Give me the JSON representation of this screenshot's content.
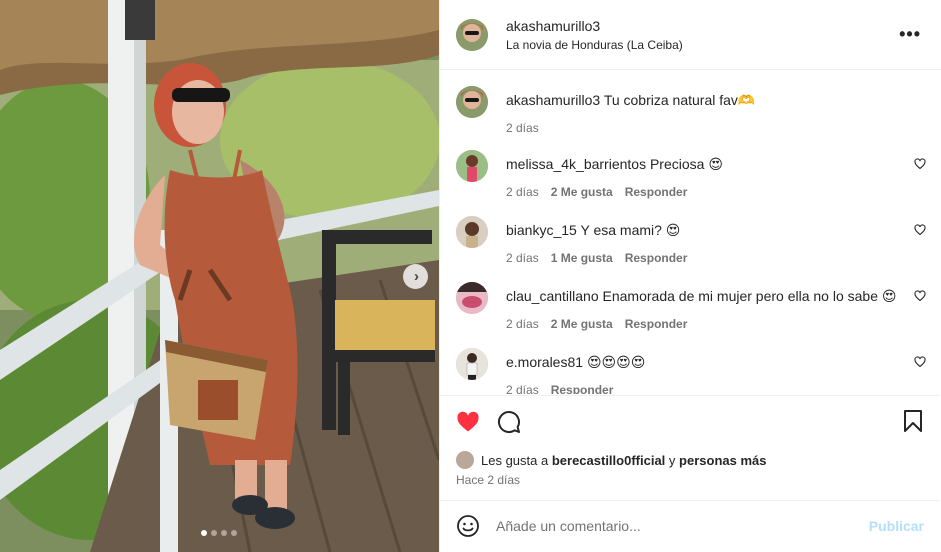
{
  "post": {
    "username": "akashamurillo3",
    "location": "La novia de Honduras (La Ceiba)",
    "more_icon": "more-horizontal-icon",
    "next_icon": "chevron-right-icon",
    "carousel": {
      "count": 4,
      "active": 0
    }
  },
  "comments": [
    {
      "user": "akashamurillo3",
      "text": "Tu cobriza natural fav🫶",
      "time": "2 días",
      "likes": "",
      "reply": "",
      "is_caption": true
    },
    {
      "user": "melissa_4k_barrientos",
      "text": "Preciosa 😍",
      "time": "2 días",
      "likes": "2 Me gusta",
      "reply": "Responder"
    },
    {
      "user": "biankyc_15",
      "text": "Y esa mami? 😍",
      "time": "2 días",
      "likes": "1 Me gusta",
      "reply": "Responder"
    },
    {
      "user": "clau_cantillano",
      "text": "Enamorada de mi mujer pero ella no lo sabe 😍",
      "time": "2 días",
      "likes": "2 Me gusta",
      "reply": "Responder"
    },
    {
      "user": "e.morales81",
      "text": "😍😍😍😍",
      "time": "2 días",
      "likes": "",
      "reply": "Responder"
    }
  ],
  "likes_line": {
    "prefix": "Les gusta a",
    "user": "berecastillo0fficial",
    "joiner": "y",
    "rest": "personas más"
  },
  "posted_ago": "Hace 2 días",
  "composer": {
    "placeholder": "Añade un comentario...",
    "publish_label": "Publicar"
  },
  "colors": {
    "like_red": "#ff3040",
    "publish_disabled": "#b2dffc",
    "muted": "#737373"
  }
}
